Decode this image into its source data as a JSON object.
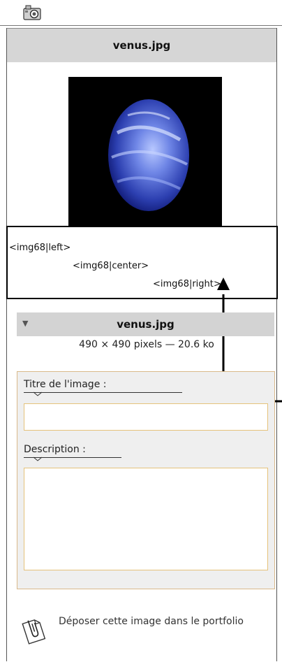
{
  "top": {
    "icon": "camera-icon"
  },
  "header": {
    "filename": "venus.jpg"
  },
  "preview": {
    "alt": "venus.jpg"
  },
  "embed_codes": [
    "<img68|left>",
    "<img68|center>",
    "<img68|right>"
  ],
  "details": {
    "filename": "venus.jpg",
    "dimensions": "490 × 490 pixels — 20.6 ko",
    "toggle_icon": "triangle-down-icon"
  },
  "form": {
    "title_label": "Titre de l'image :",
    "title_value": "",
    "description_label": "Description :",
    "description_value": ""
  },
  "deposit": {
    "label": "Déposer cette image dans le portfolio",
    "icon": "paperclip-document-icon"
  }
}
